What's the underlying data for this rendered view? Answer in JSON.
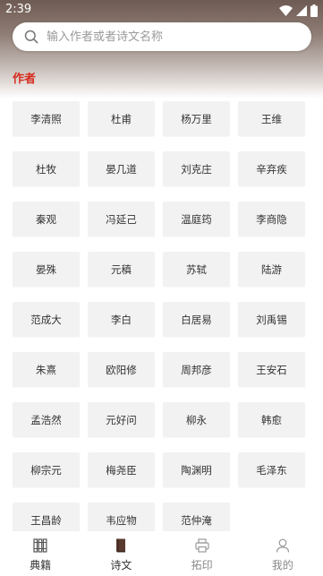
{
  "status_bar": {
    "time": "2:39"
  },
  "search": {
    "placeholder": "输入作者或者诗文名称"
  },
  "section": {
    "title": "作者"
  },
  "authors": [
    "李清照",
    "杜甫",
    "杨万里",
    "王维",
    "杜牧",
    "晏几道",
    "刘克庄",
    "辛弃疾",
    "秦观",
    "冯延己",
    "温庭筠",
    "李商隐",
    "晏殊",
    "元稹",
    "苏轼",
    "陆游",
    "范成大",
    "李白",
    "白居易",
    "刘禹锡",
    "朱熹",
    "欧阳修",
    "周邦彦",
    "王安石",
    "孟浩然",
    "元好问",
    "柳永",
    "韩愈",
    "柳宗元",
    "梅尧臣",
    "陶渊明",
    "毛泽东",
    "王昌龄",
    "韦应物",
    "范仲淹"
  ],
  "bottom_nav": [
    {
      "label": "典籍",
      "icon": "books-icon"
    },
    {
      "label": "诗文",
      "icon": "book-icon"
    },
    {
      "label": "拓印",
      "icon": "printer-icon"
    },
    {
      "label": "我的",
      "icon": "person-icon"
    }
  ],
  "colors": {
    "accent": "#d62b1e",
    "card_bg": "#f2f2f2",
    "header_gradient_top": "#6e5b53"
  }
}
